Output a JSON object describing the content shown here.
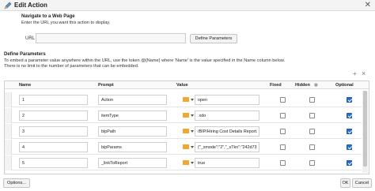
{
  "dialog": {
    "title": "Edit Action"
  },
  "navigate": {
    "heading": "Navigate to a Web Page",
    "instructions": "Enter the URL you want this action to display.",
    "url_label": "URL",
    "url_value": "",
    "define_params_label": "Define Parameters"
  },
  "params": {
    "heading": "Define Parameters",
    "line1": "To embed a parameter value anywhere within the URL, use the token @{Name} where 'Name' is the value specified in the Name column below.",
    "line2": "There is no limit to the number of parameters that can be embedded."
  },
  "table": {
    "headers": {
      "name": "Name",
      "prompt": "Prompt",
      "value": "Value",
      "fixed": "Fixed",
      "hidden": "Hidden",
      "optional": "Optional"
    },
    "rows": [
      {
        "name": "1",
        "prompt": "Action",
        "value": "open",
        "fixed": false,
        "hidden": false,
        "optional": true
      },
      {
        "name": "2",
        "prompt": "itemType",
        "value": ".xdo",
        "fixed": false,
        "hidden": false,
        "optional": true
      },
      {
        "name": "3",
        "prompt": "bipPath",
        "value": "/BIP/Hiring Cost Details Report.",
        "fixed": false,
        "hidden": false,
        "optional": true
      },
      {
        "name": "4",
        "prompt": "bipParams",
        "value": "{\"_xmode\":\"2\",\"_sTkn\":\"242d73",
        "fixed": false,
        "hidden": false,
        "optional": true
      },
      {
        "name": "5",
        "prompt": "_linkToReport",
        "value": "true",
        "fixed": false,
        "hidden": false,
        "optional": true
      }
    ]
  },
  "footer": {
    "options_label": "Options...",
    "ok_label": "OK",
    "cancel_label": "Cancel"
  },
  "colors": {
    "accent": "#2a6fcb",
    "value_icon": "#f0a830"
  }
}
